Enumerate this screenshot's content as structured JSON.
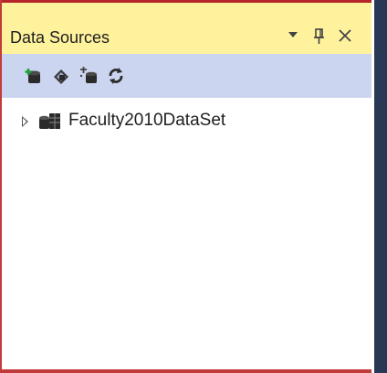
{
  "panel": {
    "title": "Data Sources",
    "buttons": {
      "dropdown": "▼",
      "pin": "ᵖ",
      "close": "✕"
    }
  },
  "toolbar": {
    "items": [
      {
        "name": "add-new-data-source",
        "icon": "add-database-icon"
      },
      {
        "name": "edit-dataset-with-designer",
        "icon": "dataset-designer-icon"
      },
      {
        "name": "configure-dataset-with-wizard",
        "icon": "configure-wizard-icon"
      },
      {
        "name": "refresh",
        "icon": "refresh-icon"
      }
    ]
  },
  "tree": {
    "nodes": [
      {
        "label": "Faculty2010DataSet",
        "icon": "dataset-icon",
        "expanded": false
      }
    ]
  },
  "colors": {
    "title_background": "#fff29d",
    "toolbar_background": "#ccd5f0",
    "frame_red": "#b7242a",
    "side_dark": "#293955"
  }
}
